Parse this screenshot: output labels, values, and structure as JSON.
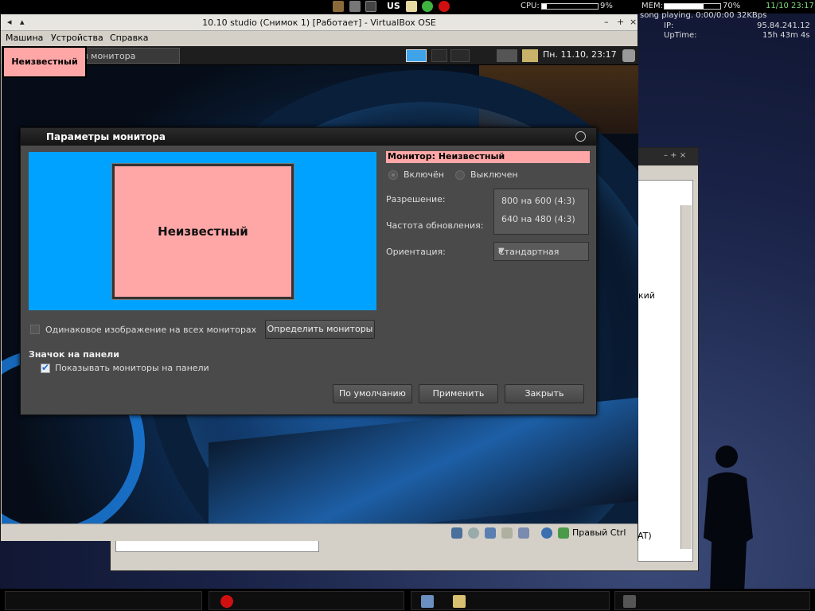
{
  "topbar": {
    "kbd_layout": "US",
    "cpu_label": "CPU:",
    "cpu_percent": 9,
    "cpu_text": "9%",
    "mem_label": "MEM:",
    "mem_percent": 70,
    "mem_text": "70%",
    "clock": "11/10 23:17"
  },
  "conky": {
    "song": "song playing. 0:00/0:00 32KBps",
    "ip_label": "IP:",
    "ip_value": "95.84.241.12",
    "uptime_label": "UpTime:",
    "uptime_value": "15h 43m 4s"
  },
  "vbox": {
    "title": "10.10 studio (Снимок 1) [Работает] - VirtualBox OSE",
    "menu": [
      "Машина",
      "Устройства",
      "Справка"
    ],
    "host_key": "Правый Ctrl"
  },
  "guest_panel": {
    "monitor_label": "Неизвестный",
    "task_label": "ры монитора",
    "clock": "Пн. 11.10, 23:17"
  },
  "dialog": {
    "title": "Параметры монитора",
    "monitor_box_label": "Неизвестный",
    "monitor_heading": "Монитор: Неизвестный",
    "radio_on": "Включён",
    "radio_off": "Выключен",
    "resolution_label": "Разрешение:",
    "resolution_options": [
      "800 на 600 (4:3)",
      "640 на 480 (4:3)"
    ],
    "refresh_label": "Частота обновления:",
    "orientation_label": "Ориентация:",
    "orientation_value": "Стандартная",
    "mirror_label": "Одинаковое изображение на всех мониторах",
    "detect_button": "Определить мониторы",
    "panel_section": "Значок на панели",
    "show_in_panel": "Показывать мониторы на панели",
    "default_button": "По умолчанию",
    "apply_button": "Применить",
    "close_button": "Закрыть"
  },
  "bgwin": {
    "partial_text_1": "кий",
    "partial_text_2": "AT)"
  },
  "colors": {
    "monitor_bg": "#00a2ff",
    "monitor_pink": "#ffa7a7",
    "dialog_bg": "#4a4a4a"
  }
}
